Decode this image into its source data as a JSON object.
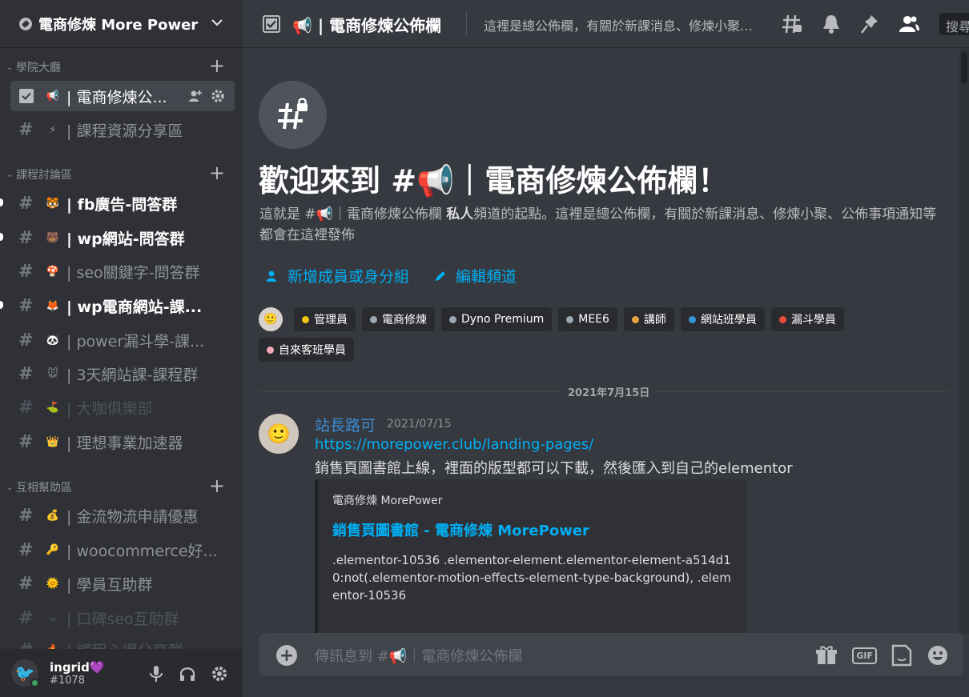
{
  "server": {
    "name": "電商修煉 More Power"
  },
  "categories": [
    {
      "name": "學院大廳"
    },
    {
      "name": "課程討論區"
    },
    {
      "name": "互相幫助區"
    }
  ],
  "channels": [
    {
      "emoji": "📢",
      "label": "| 電商修煉公...",
      "state": "active"
    },
    {
      "emoji": "⚡",
      "label": "| 課程資源分享區",
      "state": "normal"
    },
    {
      "emoji": "🐯",
      "label": "| fb廣告-問答群",
      "state": "unread"
    },
    {
      "emoji": "🐻",
      "label": "| wp網站-問答群",
      "state": "unread"
    },
    {
      "emoji": "🍄",
      "label": "| seo關鍵字-問答群",
      "state": "normal"
    },
    {
      "emoji": "🦊",
      "label": "| wp電商網站-課...",
      "state": "unread"
    },
    {
      "emoji": "🐼",
      "label": "| power漏斗學-課...",
      "state": "normal"
    },
    {
      "emoji": "🐭",
      "label": "| 3天網站課-課程群",
      "state": "normal"
    },
    {
      "emoji": "⛳",
      "label": "| 大咖俱樂部",
      "state": "muted"
    },
    {
      "emoji": "👑",
      "label": "| 理想事業加速器",
      "state": "normal"
    },
    {
      "emoji": "💰",
      "label": "| 金流物流申請優惠",
      "state": "normal"
    },
    {
      "emoji": "🔑",
      "label": "| woocommerce好...",
      "state": "normal"
    },
    {
      "emoji": "🌞",
      "label": "| 學員互助群",
      "state": "normal"
    },
    {
      "emoji": "☕",
      "label": "| 口碑seo互助群",
      "state": "muted"
    },
    {
      "emoji": "🔥",
      "label": "| 課程心得分享群",
      "state": "muted"
    }
  ],
  "user": {
    "name": "ingrid",
    "badge": "💜",
    "tag": "#1078"
  },
  "topbar": {
    "channel_emoji": "📢",
    "channel_title": "| 電商修煉公佈欄",
    "topic": "這裡是總公佈欄，有關於新課消息、修煉小聚、公佈事項通知等都會在這裡發佈",
    "search_label": "搜尋"
  },
  "welcome": {
    "title_prefix": "歡迎來到 #",
    "title_emoji": "📢",
    "title_suffix": "｜電商修煉公佈欄！",
    "desc_prefix": "這就是 #",
    "desc_emoji": "📢",
    "desc_channel": "｜電商修煉公佈欄",
    "desc_bold": "私人",
    "desc_rest": "頻道的起點。這裡是總公佈欄，有關於新課消息、修煉小聚、公佈事項通知等都會在這裡發佈",
    "add_members": "新增成員或身分組",
    "edit_channel": "編輯頻道"
  },
  "roles": [
    {
      "name": "管理員",
      "color": "#f1c40f"
    },
    {
      "name": "電商修煉",
      "color": "#99aab5"
    },
    {
      "name": "Dyno Premium",
      "color": "#99aab5"
    },
    {
      "name": "MEE6",
      "color": "#99aab5"
    },
    {
      "name": "講師",
      "color": "#e6a23c"
    },
    {
      "name": "網站班學員",
      "color": "#3498db"
    },
    {
      "name": "漏斗學員",
      "color": "#e74c3c"
    },
    {
      "name": "自來客班學員",
      "color": "#f5a9b8"
    }
  ],
  "date_divider": "2021年7月15日",
  "message": {
    "author": "站長路可",
    "timestamp": "2021/07/15",
    "link": "https://morepower.club/landing-pages/",
    "text": "銷售頁圖書館上線，裡面的版型都可以下載，然後匯入到自己的elementor",
    "embed": {
      "provider": "電商修煉 MorePower",
      "title": "銷售頁圖書館 - 電商修煉 MorePower",
      "description": ".elementor-10536 .elementor-element.elementor-element-a514d10:not(.elementor-motion-effects-element-type-background), .elementor-10536"
    }
  },
  "composer": {
    "placeholder_prefix": "傳訊息到 #",
    "placeholder_emoji": "📢",
    "placeholder_suffix": "｜電商修煉公佈欄",
    "gif_label": "GIF"
  },
  "colors": {
    "link": "#00aff4",
    "author": "#3b8ed8",
    "online": "#3ba55d"
  }
}
